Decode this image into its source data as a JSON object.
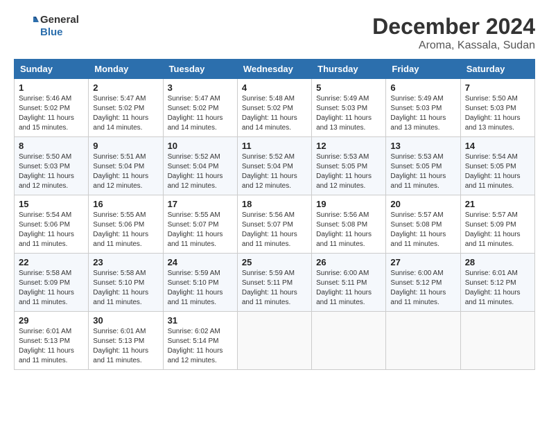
{
  "header": {
    "logo_line1": "General",
    "logo_line2": "Blue",
    "month_title": "December 2024",
    "location": "Aroma, Kassala, Sudan"
  },
  "columns": [
    "Sunday",
    "Monday",
    "Tuesday",
    "Wednesday",
    "Thursday",
    "Friday",
    "Saturday"
  ],
  "weeks": [
    [
      {
        "day": "1",
        "info": "Sunrise: 5:46 AM\nSunset: 5:02 PM\nDaylight: 11 hours\nand 15 minutes."
      },
      {
        "day": "2",
        "info": "Sunrise: 5:47 AM\nSunset: 5:02 PM\nDaylight: 11 hours\nand 14 minutes."
      },
      {
        "day": "3",
        "info": "Sunrise: 5:47 AM\nSunset: 5:02 PM\nDaylight: 11 hours\nand 14 minutes."
      },
      {
        "day": "4",
        "info": "Sunrise: 5:48 AM\nSunset: 5:02 PM\nDaylight: 11 hours\nand 14 minutes."
      },
      {
        "day": "5",
        "info": "Sunrise: 5:49 AM\nSunset: 5:03 PM\nDaylight: 11 hours\nand 13 minutes."
      },
      {
        "day": "6",
        "info": "Sunrise: 5:49 AM\nSunset: 5:03 PM\nDaylight: 11 hours\nand 13 minutes."
      },
      {
        "day": "7",
        "info": "Sunrise: 5:50 AM\nSunset: 5:03 PM\nDaylight: 11 hours\nand 13 minutes."
      }
    ],
    [
      {
        "day": "8",
        "info": "Sunrise: 5:50 AM\nSunset: 5:03 PM\nDaylight: 11 hours\nand 12 minutes."
      },
      {
        "day": "9",
        "info": "Sunrise: 5:51 AM\nSunset: 5:04 PM\nDaylight: 11 hours\nand 12 minutes."
      },
      {
        "day": "10",
        "info": "Sunrise: 5:52 AM\nSunset: 5:04 PM\nDaylight: 11 hours\nand 12 minutes."
      },
      {
        "day": "11",
        "info": "Sunrise: 5:52 AM\nSunset: 5:04 PM\nDaylight: 11 hours\nand 12 minutes."
      },
      {
        "day": "12",
        "info": "Sunrise: 5:53 AM\nSunset: 5:05 PM\nDaylight: 11 hours\nand 12 minutes."
      },
      {
        "day": "13",
        "info": "Sunrise: 5:53 AM\nSunset: 5:05 PM\nDaylight: 11 hours\nand 11 minutes."
      },
      {
        "day": "14",
        "info": "Sunrise: 5:54 AM\nSunset: 5:05 PM\nDaylight: 11 hours\nand 11 minutes."
      }
    ],
    [
      {
        "day": "15",
        "info": "Sunrise: 5:54 AM\nSunset: 5:06 PM\nDaylight: 11 hours\nand 11 minutes."
      },
      {
        "day": "16",
        "info": "Sunrise: 5:55 AM\nSunset: 5:06 PM\nDaylight: 11 hours\nand 11 minutes."
      },
      {
        "day": "17",
        "info": "Sunrise: 5:55 AM\nSunset: 5:07 PM\nDaylight: 11 hours\nand 11 minutes."
      },
      {
        "day": "18",
        "info": "Sunrise: 5:56 AM\nSunset: 5:07 PM\nDaylight: 11 hours\nand 11 minutes."
      },
      {
        "day": "19",
        "info": "Sunrise: 5:56 AM\nSunset: 5:08 PM\nDaylight: 11 hours\nand 11 minutes."
      },
      {
        "day": "20",
        "info": "Sunrise: 5:57 AM\nSunset: 5:08 PM\nDaylight: 11 hours\nand 11 minutes."
      },
      {
        "day": "21",
        "info": "Sunrise: 5:57 AM\nSunset: 5:09 PM\nDaylight: 11 hours\nand 11 minutes."
      }
    ],
    [
      {
        "day": "22",
        "info": "Sunrise: 5:58 AM\nSunset: 5:09 PM\nDaylight: 11 hours\nand 11 minutes."
      },
      {
        "day": "23",
        "info": "Sunrise: 5:58 AM\nSunset: 5:10 PM\nDaylight: 11 hours\nand 11 minutes."
      },
      {
        "day": "24",
        "info": "Sunrise: 5:59 AM\nSunset: 5:10 PM\nDaylight: 11 hours\nand 11 minutes."
      },
      {
        "day": "25",
        "info": "Sunrise: 5:59 AM\nSunset: 5:11 PM\nDaylight: 11 hours\nand 11 minutes."
      },
      {
        "day": "26",
        "info": "Sunrise: 6:00 AM\nSunset: 5:11 PM\nDaylight: 11 hours\nand 11 minutes."
      },
      {
        "day": "27",
        "info": "Sunrise: 6:00 AM\nSunset: 5:12 PM\nDaylight: 11 hours\nand 11 minutes."
      },
      {
        "day": "28",
        "info": "Sunrise: 6:01 AM\nSunset: 5:12 PM\nDaylight: 11 hours\nand 11 minutes."
      }
    ],
    [
      {
        "day": "29",
        "info": "Sunrise: 6:01 AM\nSunset: 5:13 PM\nDaylight: 11 hours\nand 11 minutes."
      },
      {
        "day": "30",
        "info": "Sunrise: 6:01 AM\nSunset: 5:13 PM\nDaylight: 11 hours\nand 11 minutes."
      },
      {
        "day": "31",
        "info": "Sunrise: 6:02 AM\nSunset: 5:14 PM\nDaylight: 11 hours\nand 12 minutes."
      },
      {
        "day": "",
        "info": ""
      },
      {
        "day": "",
        "info": ""
      },
      {
        "day": "",
        "info": ""
      },
      {
        "day": "",
        "info": ""
      }
    ]
  ]
}
